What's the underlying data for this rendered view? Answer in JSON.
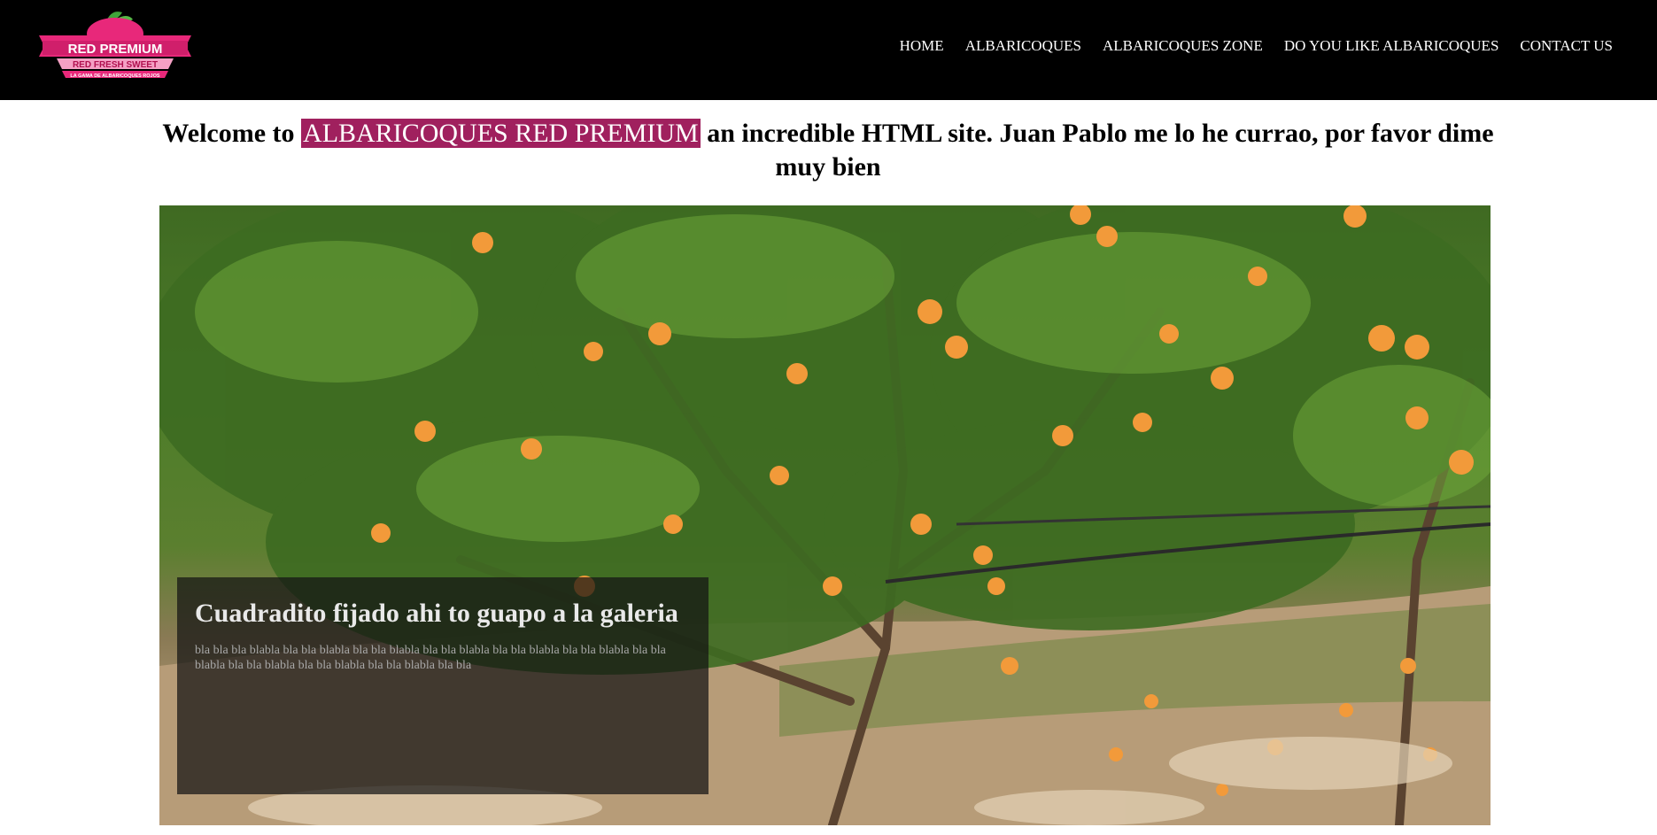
{
  "header": {
    "logo": {
      "brand": "RED PREMIUM",
      "tagline": "RED FRESH SWEET",
      "subline": "LA GAMA DE ALBARICOQUES ROJOS"
    },
    "nav": [
      {
        "label": "HOME"
      },
      {
        "label": "ALBARICOQUES"
      },
      {
        "label": "ALBARICOQUES ZONE"
      },
      {
        "label": "DO YOU LIKE ALBARICOQUES"
      },
      {
        "label": "CONTACT US"
      }
    ]
  },
  "welcome": {
    "prefix": "Welcome to",
    "highlight": "ALBARICOQUES RED PREMIUM",
    "suffix": "an incredible HTML site. Juan Pablo me lo he currao, por favor dime muy bien"
  },
  "hero": {
    "caption_title": "Cuadradito fijado ahi to guapo a la galeria",
    "caption_text": "bla bla bla blabla bla bla blabla bla bla blabla bla bla blabla bla bla blabla bla bla blabla bla bla blabla bla bla blabla bla bla blabla bla bla blabla bla bla"
  },
  "colors": {
    "topbar": "#000000",
    "highlight": "#a0205e",
    "logo_pink": "#e8287a"
  }
}
